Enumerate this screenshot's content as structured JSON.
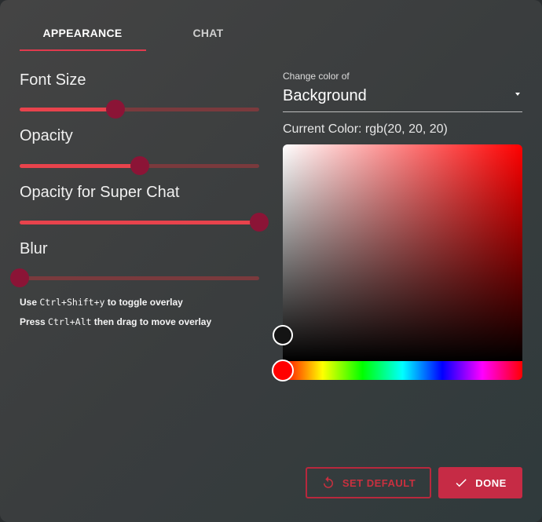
{
  "tabs": {
    "appearance": "APPEARANCE",
    "chat": "CHAT",
    "active": "APPEARANCE"
  },
  "sliders": [
    {
      "label": "Font Size",
      "value_percent": 40
    },
    {
      "label": "Opacity",
      "value_percent": 50
    },
    {
      "label": "Opacity for Super Chat",
      "value_percent": 100
    },
    {
      "label": "Blur",
      "value_percent": 0
    }
  ],
  "hints": {
    "toggle": {
      "prefix": "Use",
      "keys": "Ctrl+Shift+y",
      "suffix": "to toggle overlay"
    },
    "move": {
      "prefix": "Press",
      "keys": "Ctrl+Alt",
      "suffix": "then drag to move overlay"
    }
  },
  "color_picker": {
    "select_caption": "Change color of",
    "selected_target": "Background",
    "current_color_text": "Current Color: rgb(20, 20, 20)",
    "hue": "#ff0000",
    "current_color": "#141414"
  },
  "buttons": {
    "set_default": "SET DEFAULT",
    "done": "DONE"
  },
  "colors": {
    "accent": "#e03a4e",
    "slider_thumb": "#8b1436",
    "done_button": "#c62b45"
  },
  "icons": {
    "set_default": "reset-icon",
    "done": "check-icon",
    "select": "caret-down-icon"
  }
}
